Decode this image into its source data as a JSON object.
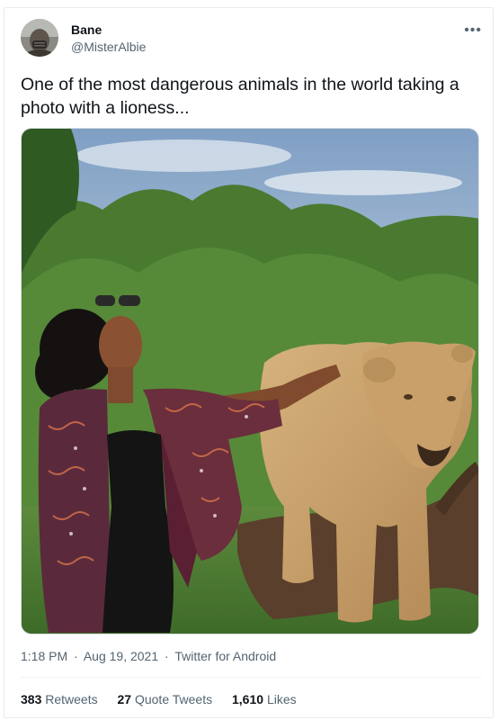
{
  "user": {
    "name": "Bane",
    "handle": "@MisterAlbie"
  },
  "tweet": {
    "text": "One of the most dangerous animals in the world taking a photo with a lioness..."
  },
  "meta": {
    "time": "1:18 PM",
    "date": "Aug 19, 2021",
    "separator": "·",
    "source": "Twitter for Android"
  },
  "stats": {
    "retweets_count": "383",
    "retweets_label": "Retweets",
    "quotes_count": "27",
    "quotes_label": "Quote Tweets",
    "likes_count": "1,610",
    "likes_label": "Likes"
  },
  "icons": {
    "more": "more-horizontal-icon"
  },
  "colors": {
    "secondary_text": "#536471",
    "primary_text": "#0f1419",
    "border": "#e6ecf0"
  }
}
